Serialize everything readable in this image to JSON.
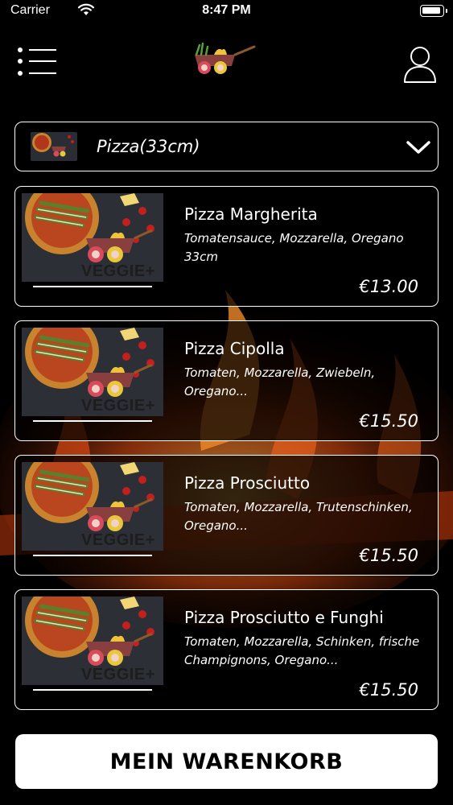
{
  "status_bar": {
    "carrier": "Carrier",
    "time": "8:47 PM"
  },
  "header": {
    "menu_icon": "list-menu-icon",
    "logo_icon": "veggie-cart-logo",
    "user_icon": "user-profile-icon"
  },
  "category": {
    "label": "Pizza(33cm)",
    "icon": "chevron-down-icon"
  },
  "products": [
    {
      "name": "Pizza Margherita",
      "description": "Tomatensauce, Mozzarella, Oregano 33cm",
      "price": "€13.00",
      "badge": "VEGGIE+"
    },
    {
      "name": "Pizza Cipolla",
      "description": "Tomaten, Mozzarella, Zwiebeln, Oregano...",
      "price": "€15.50",
      "badge": "VEGGIE+"
    },
    {
      "name": "Pizza Prosciutto",
      "description": "Tomaten, Mozzarella, Trutenschinken, Oregano...",
      "price": "€15.50",
      "badge": "VEGGIE+"
    },
    {
      "name": "Pizza Prosciutto e Funghi",
      "description": "Tomaten, Mozzarella, Schinken, frische Champignons, Oregano...",
      "price": "€15.50",
      "badge": "VEGGIE+"
    }
  ],
  "cart": {
    "label": "MEIN WARENKORB"
  },
  "colors": {
    "background": "#000000",
    "foreground": "#ffffff",
    "button_background": "#ffffff",
    "button_text": "#000000",
    "fire": "#e8601c"
  }
}
